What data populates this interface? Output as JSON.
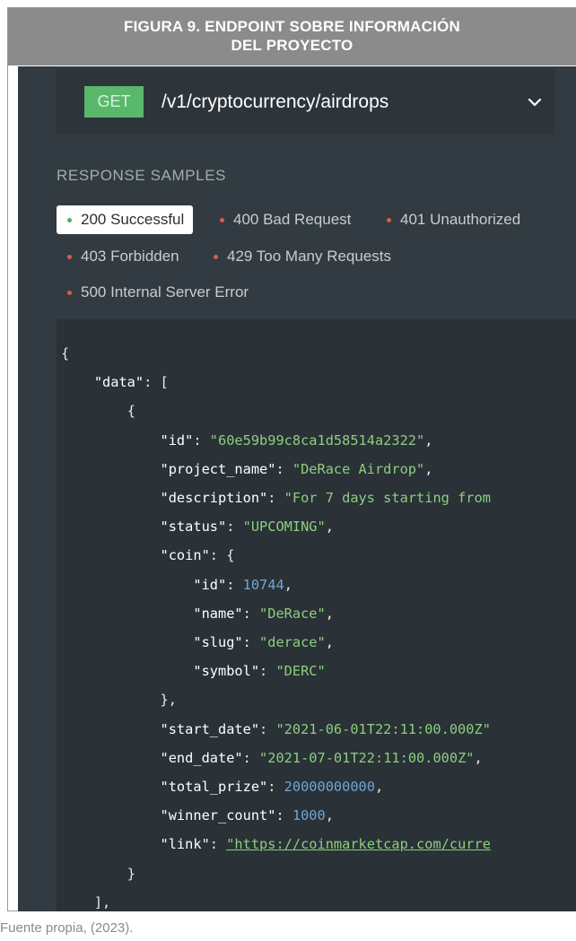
{
  "figure": {
    "caption_line1": "FIGURA 9. ENDPOINT SOBRE INFORMACIÓN",
    "caption_line2": "DEL PROYECTO",
    "source": "Fuente propia, (2023)."
  },
  "endpoint": {
    "method": "GET",
    "path": "/v1/cryptocurrency/airdrops",
    "expand_icon": "chevron-down-icon"
  },
  "responses": {
    "title": "RESPONSE SAMPLES",
    "tabs": [
      {
        "label": "200 Successful",
        "active": true
      },
      {
        "label": "400 Bad Request",
        "active": false
      },
      {
        "label": "401 Unauthorized",
        "active": false
      },
      {
        "label": "403 Forbidden",
        "active": false
      },
      {
        "label": "429 Too Many Requests",
        "active": false
      },
      {
        "label": "500 Internal Server Error",
        "active": false
      }
    ]
  },
  "code": {
    "open_brace": "{",
    "data_key": "\"data\"",
    "open_bracket": "[",
    "obj_open": "{",
    "id_key": "\"id\"",
    "id_val": "\"60e59b99c8ca1d58514a2322\"",
    "project_name_key": "\"project_name\"",
    "project_name_val": "\"DeRace Airdrop\"",
    "description_key": "\"description\"",
    "description_val": "\"For 7 days starting from",
    "status_key": "\"status\"",
    "status_val": "\"UPCOMING\"",
    "coin_key": "\"coin\"",
    "coin_id_key": "\"id\"",
    "coin_id_val": "10744",
    "coin_name_key": "\"name\"",
    "coin_name_val": "\"DeRace\"",
    "coin_slug_key": "\"slug\"",
    "coin_slug_val": "\"derace\"",
    "coin_symbol_key": "\"symbol\"",
    "coin_symbol_val": "\"DERC\"",
    "coin_close": "},",
    "start_date_key": "\"start_date\"",
    "start_date_val": "\"2021-06-01T22:11:00.000Z\"",
    "end_date_key": "\"end_date\"",
    "end_date_val": "\"2021-07-01T22:11:00.000Z\"",
    "total_prize_key": "\"total_prize\"",
    "total_prize_val": "20000000000",
    "winner_count_key": "\"winner_count\"",
    "winner_count_val": "1000",
    "link_key": "\"link\"",
    "link_val": "\"https://coinmarketcap.com/curre",
    "obj_close": "}",
    "array_close": "],"
  },
  "colors": {
    "panel_bg": "#323b41",
    "code_bg": "#2a3137",
    "get_badge": "#59b86b",
    "string": "#8ccf7e",
    "number": "#6fa7d6",
    "error_dot": "#e05a4f",
    "success_dot": "#4caf64"
  }
}
